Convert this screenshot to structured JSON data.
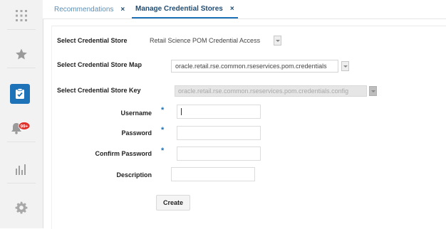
{
  "tabs": [
    {
      "label": "Recommendations",
      "close": "×"
    },
    {
      "label": "Manage Credential Stores",
      "close": "×"
    }
  ],
  "sidebar": {
    "items": [
      {
        "icon": "grid-icon"
      },
      {
        "icon": "star-icon"
      },
      {
        "icon": "clipboard-check-icon"
      },
      {
        "icon": "notification-bell-icon",
        "badge": "99+"
      },
      {
        "icon": "bar-chart-icon"
      },
      {
        "icon": "gear-icon"
      }
    ]
  },
  "form": {
    "credential_store_label": "Select Credential Store",
    "credential_store_value": "Retail Science POM Credential Access",
    "store_map_label": "Select Credential Store Map",
    "store_map_value": "oracle.retail.rse.common.rseservices.pom.credentials",
    "store_key_label": "Select Credential Store Key",
    "store_key_value": "oracle.retail.rse.common.rseservices.pom.credentials.config",
    "username_label": "Username",
    "username_value": "",
    "password_label": "Password",
    "password_value": "",
    "confirm_password_label": "Confirm Password",
    "confirm_password_value": "",
    "description_label": "Description",
    "description_value": "",
    "required_marker": "*",
    "create_button": "Create"
  },
  "colors": {
    "accent": "#1e72b8",
    "tab_active_text": "#1f4c73",
    "tab_inactive_text": "#5d8fb5"
  }
}
